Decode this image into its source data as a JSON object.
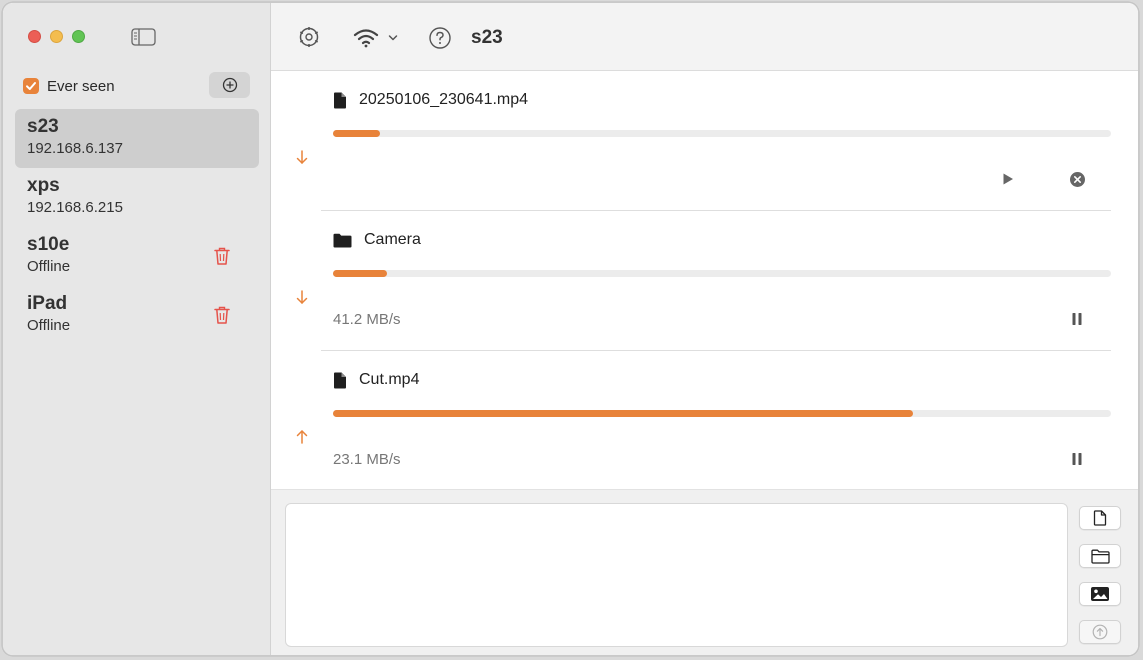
{
  "sidebar": {
    "ever_seen_label": "Ever seen",
    "ever_seen_checked": true,
    "devices": [
      {
        "name": "s23",
        "status": "192.168.6.137",
        "selected": true,
        "deletable": false
      },
      {
        "name": "xps",
        "status": "192.168.6.215",
        "selected": false,
        "deletable": false
      },
      {
        "name": "s10e",
        "status": "Offline",
        "selected": false,
        "deletable": true
      },
      {
        "name": "iPad",
        "status": "Offline",
        "selected": false,
        "deletable": true
      }
    ]
  },
  "toolbar": {
    "title": "s23",
    "icons": [
      "settings-icon",
      "wifi-icon",
      "chevron-down-icon",
      "help-icon"
    ]
  },
  "transfers": [
    {
      "name": "20250106_230641.mp4",
      "kind": "file",
      "direction": "down",
      "progress": 0.06,
      "speed": "",
      "controls": [
        "play-icon",
        "cancel-icon"
      ]
    },
    {
      "name": "Camera",
      "kind": "folder",
      "direction": "down",
      "progress": 0.07,
      "speed": "41.2 MB/s",
      "controls": [
        "pause-icon"
      ]
    },
    {
      "name": "Cut.mp4",
      "kind": "file",
      "direction": "up",
      "progress": 0.745,
      "speed": "23.1 MB/s",
      "controls": [
        "pause-icon"
      ]
    }
  ],
  "compose": {
    "buttons": [
      "send-file-icon",
      "send-folder-icon",
      "send-image-icon",
      "send-icon"
    ]
  },
  "colors": {
    "accent": "#e8833a",
    "danger": "#e5534b",
    "sidebar_bg": "#e7e7e7",
    "selected_bg": "#cecece"
  }
}
